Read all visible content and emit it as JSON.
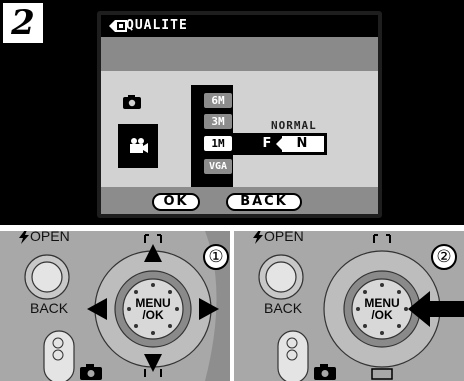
{
  "step": {
    "number": "2"
  },
  "lcd": {
    "title": "QUALITE",
    "sizes": [
      "6M",
      "3M",
      "1M",
      "VGA"
    ],
    "selected_size": "1M",
    "quality_label": "NORMAL",
    "quality_options": [
      "F",
      "N"
    ],
    "selected_quality": "N",
    "buttons": {
      "ok": "OK",
      "back": "BACK"
    }
  },
  "cameras": [
    {
      "open_label": "OPEN",
      "back_label": "BACK",
      "menu_ok_label": "MENU\n/OK",
      "step_marker": "①"
    },
    {
      "open_label": "OPEN",
      "back_label": "BACK",
      "menu_ok_label": "MENU\n/OK",
      "step_marker": "②"
    }
  ],
  "colors": {
    "background": "#000000",
    "lcd_panel": "#d2d2d2",
    "camera_body": "#a8a8a8"
  },
  "icons": [
    "camera-icon",
    "movie-icon",
    "quality-icon",
    "arrow-up-icon",
    "arrow-down-icon",
    "arrow-left-icon",
    "arrow-right-icon",
    "press-arrow-icon",
    "flash-icon"
  ]
}
